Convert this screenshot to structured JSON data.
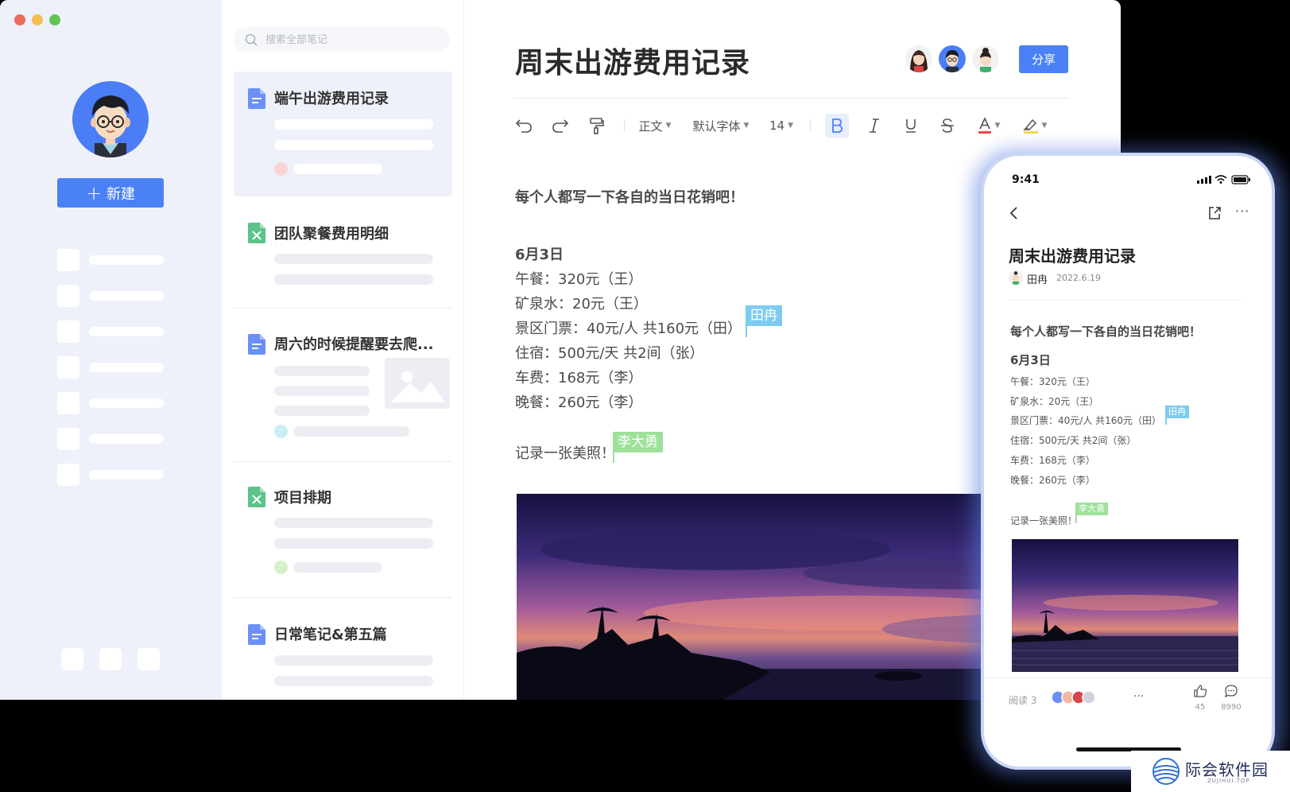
{
  "colors": {
    "accent": "#4a82f6",
    "sidebar_bg": "#eef1fa",
    "tag_blue": "#7ecbf0",
    "tag_green": "#9fe09a",
    "dot_pink": "#fad3d6",
    "dot_cyan": "#c9eef4",
    "dot_green": "#d6f0c8",
    "doc_icon": "#6b8ff5",
    "sheet_icon": "#5cc289"
  },
  "sidebar": {
    "new_label": "新建"
  },
  "notelist": {
    "search_placeholder": "搜索全部笔记",
    "items": [
      {
        "title": "端午出游费用记录",
        "type": "doc"
      },
      {
        "title": "团队聚餐费用明细",
        "type": "sheet"
      },
      {
        "title": "周六的时候提醒要去爬...",
        "type": "doc"
      },
      {
        "title": "项目排期",
        "type": "sheet"
      },
      {
        "title": "日常笔记&第五篇",
        "type": "doc"
      }
    ]
  },
  "editor": {
    "title": "周末出游费用记录",
    "share_label": "分享",
    "toolbar": {
      "style": "正文",
      "font": "默认字体",
      "size": "14"
    },
    "body": {
      "intro": "每个人都写一下各自的当日花销吧！",
      "date": "6月3日",
      "lines": [
        "午餐：320元（王）",
        "矿泉水：20元（王）",
        "景区门票：40元/人  共160元（田）",
        "住宿：500元/天  共2间（张）",
        "车费：168元（李）",
        "晚餐：260元（李）"
      ],
      "closing": "记录一张美照！"
    },
    "cursors": [
      {
        "name": "田冉"
      },
      {
        "name": "李大勇"
      }
    ]
  },
  "phone": {
    "time": "9:41",
    "title": "周末出游费用记录",
    "author": "田冉",
    "date": "2022.6.19",
    "reads_label": "阅读 3",
    "likes": "45",
    "comments": "8990"
  },
  "watermark": {
    "name": "际会软件园",
    "sub": "ZUJIHUI.TOP"
  }
}
